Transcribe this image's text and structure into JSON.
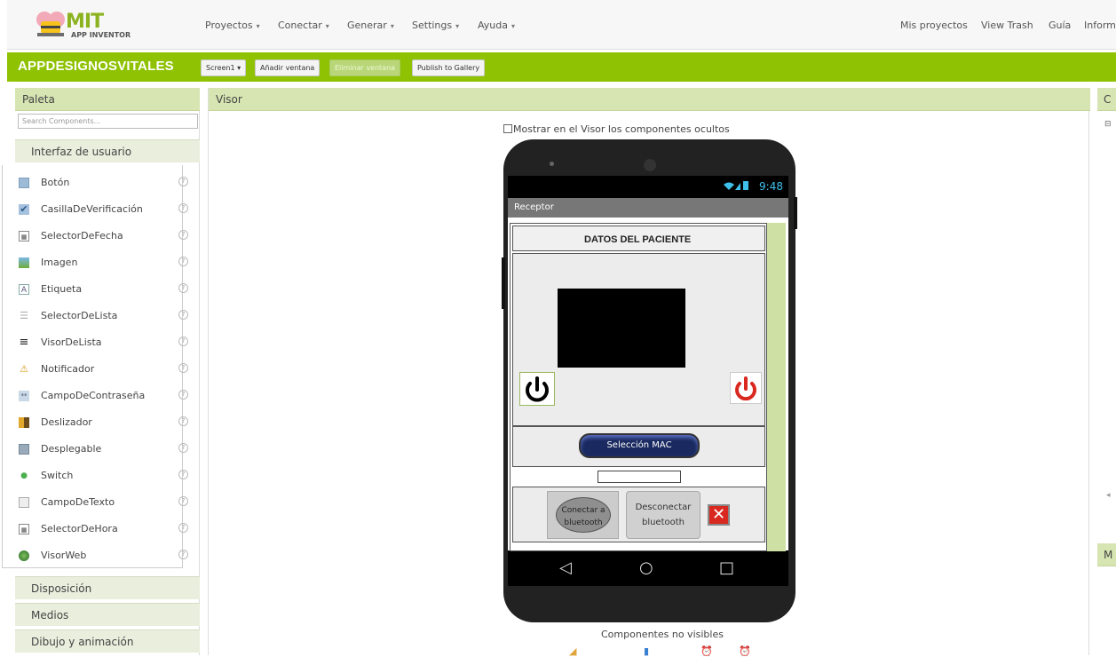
{
  "header": {
    "logo_main": "MIT",
    "logo_sub": "APP INVENTOR",
    "menus": [
      {
        "label": "Proyectos",
        "caret": "▾"
      },
      {
        "label": "Conectar",
        "caret": "▾"
      },
      {
        "label": "Generar",
        "caret": "▾"
      },
      {
        "label": "Settings",
        "caret": "▾"
      },
      {
        "label": "Ayuda",
        "caret": "▾"
      }
    ],
    "right_links": [
      "Mis proyectos",
      "View Trash",
      "Guía",
      "Inform"
    ]
  },
  "project": {
    "name": "APPDESIGNOSVITALES",
    "screen_select": "Screen1 ▾",
    "add_screen": "Añadir ventana",
    "remove_screen": "Eliminar ventana",
    "publish": "Publish to Gallery"
  },
  "palette": {
    "title": "Paleta",
    "search_placeholder": "Search Components...",
    "open_section": "Interfaz de usuario",
    "components": [
      {
        "label": "Botón",
        "icon": "button-icon"
      },
      {
        "label": "CasillaDeVerificación",
        "icon": "checkbox-icon"
      },
      {
        "label": "SelectorDeFecha",
        "icon": "datepicker-icon"
      },
      {
        "label": "Imagen",
        "icon": "image-icon"
      },
      {
        "label": "Etiqueta",
        "icon": "label-icon"
      },
      {
        "label": "SelectorDeLista",
        "icon": "listpicker-icon"
      },
      {
        "label": "VisorDeLista",
        "icon": "listview-icon"
      },
      {
        "label": "Notificador",
        "icon": "notifier-icon"
      },
      {
        "label": "CampoDeContraseña",
        "icon": "password-icon"
      },
      {
        "label": "Deslizador",
        "icon": "slider-icon"
      },
      {
        "label": "Desplegable",
        "icon": "spinner-icon"
      },
      {
        "label": "Switch",
        "icon": "switch-icon"
      },
      {
        "label": "CampoDeTexto",
        "icon": "textbox-icon"
      },
      {
        "label": "SelectorDeHora",
        "icon": "timepicker-icon"
      },
      {
        "label": "VisorWeb",
        "icon": "webviewer-icon"
      }
    ],
    "help_glyph": "?",
    "other_sections": [
      "Disposición",
      "Medios",
      "Dibujo y animación"
    ]
  },
  "viewer": {
    "title": "Visor",
    "show_hidden_label": "Mostrar en el Visor los componentes ocultos",
    "phone": {
      "time": "9:48",
      "screen_title": "Receptor",
      "heading": "DATOS DEL PACIENTE",
      "mac_button": "Selección MAC",
      "connect_button": "Conectar a bluetooth",
      "disconnect_button": "Desconectar bluetooth",
      "close_glyph": "✕",
      "nav_back": "◁",
      "nav_home": "○",
      "nav_recent": "□"
    },
    "non_visible_label": "Componentes no visibles"
  },
  "right_panels": {
    "components_title_partial": "C",
    "properties_title_partial": "M"
  },
  "colors": {
    "project_bar": "#8fc202",
    "panel_header": "#d7e5b3",
    "status_text": "#3fc0ea",
    "power_red": "#d9281f",
    "mac_button": "#1a2a60"
  }
}
